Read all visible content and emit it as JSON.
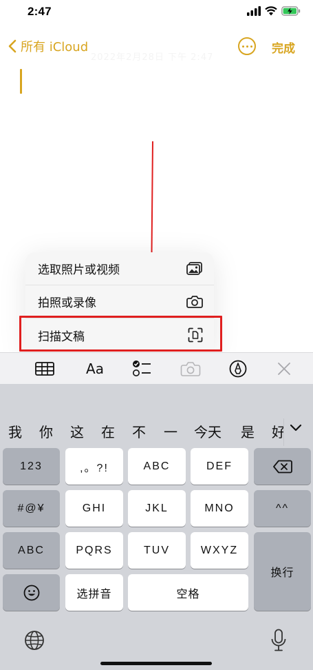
{
  "status": {
    "time": "2:47"
  },
  "nav": {
    "back_label": "所有 iCloud",
    "done_label": "完成"
  },
  "note": {
    "date_text": "2022年2月28日 下午 2:47"
  },
  "menu": {
    "items": [
      {
        "label": "选取照片或视频",
        "icon": "photo-library-icon"
      },
      {
        "label": "拍照或录像",
        "icon": "camera-icon"
      },
      {
        "label": "扫描文稿",
        "icon": "document-scan-icon"
      }
    ]
  },
  "toolbar": {
    "items": [
      {
        "icon": "table-icon"
      },
      {
        "label": "Aa",
        "icon": "text-format-icon"
      },
      {
        "icon": "checklist-icon"
      },
      {
        "icon": "camera-icon"
      },
      {
        "icon": "markup-pen-icon"
      },
      {
        "icon": "close-icon"
      }
    ]
  },
  "keyboard": {
    "candidates": [
      "我",
      "你",
      "这",
      "在",
      "不",
      "一",
      "今天",
      "是",
      "好"
    ],
    "keys": {
      "num": "123",
      "punct": ",。?!",
      "abc": "ABC",
      "def": "DEF",
      "symbols": "#@¥",
      "ghi": "GHI",
      "jkl": "JKL",
      "mno": "MNO",
      "caret": "^^",
      "abc_switch": "ABC",
      "pqrs": "PQRS",
      "tuv": "TUV",
      "wxyz": "WXYZ",
      "return": "换行",
      "select_pinyin": "选拼音",
      "space": "空格"
    }
  },
  "colors": {
    "accent": "#d8a520",
    "annotation": "#e01f1f"
  }
}
